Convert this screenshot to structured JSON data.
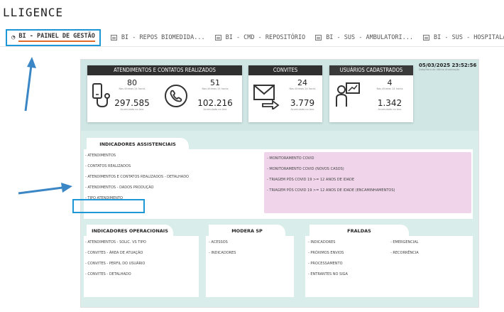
{
  "app": {
    "title": "LLIGENCE"
  },
  "tabs": [
    {
      "label": "BI - PAINEL DE GESTÃO",
      "active": true
    },
    {
      "label": "BI - REPOS BIOMEDIDA..."
    },
    {
      "label": "BI - CMD - REPOSITÓRIO"
    },
    {
      "label": "BI - SUS - AMBULATORI..."
    },
    {
      "label": "BI - SUS - HOSPITALAR"
    }
  ],
  "timestamp": {
    "value": "05/03/2025 23:52:56",
    "label": "Data/Hora da Última Atualização"
  },
  "cards": {
    "atendimentos": {
      "title": "ATENDIMENTOS E CONTATOS REALIZADOS",
      "left": {
        "value24": "80",
        "sub24": "Nas últimas 24 horas",
        "valueYear": "297.585",
        "subYear": "Acumulado no Ano"
      },
      "right": {
        "value24": "51",
        "sub24": "Nas últimas 24 horas",
        "valueYear": "102.216",
        "subYear": "Acumulado no Ano"
      }
    },
    "convites": {
      "title": "CONVITES",
      "value24": "24",
      "sub24": "Nas últimas 24 horas",
      "valueYear": "3.779",
      "subYear": "Acumulado no Ano"
    },
    "usuarios": {
      "title": "USUÁRIOS CADASTRADOS",
      "value24": "4",
      "sub24": "Nas últimas 24 horas",
      "valueYear": "1.342",
      "subYear": "Acumulado no Ano"
    }
  },
  "assistenciais": {
    "title": "INDICADORES ASSISTENCIAIS",
    "left_items": [
      "- ATENDIMENTOS",
      "- CONTATOS REALIZADOS",
      "- ATENDIMENTOS E CONTATOS REALIZADOS - DETALHADO",
      "- ATENDIMENTOS - DADOS PRODUÇÃO",
      "- TIPO ATENDIMENTO"
    ],
    "right_items": [
      "- MONITORAMENTO COVID",
      "- MONITORAMENTO COVID (NOVOS CASOS)",
      "- TRIAGEM PÓS COVID 19 >= 12 ANOS DE IDADE",
      "- TRIAGEM PÓS COVID 19 >= 12 ANOS DE IDADE (ENCAMINHAMENTOS)"
    ]
  },
  "operacionais": {
    "title": "INDICADORES OPERACIONAIS",
    "items": [
      "- ATENDIMENTOS - SOLIC. VS TIPO",
      "- CONVITES - ÁREA DE ATUAÇÃO",
      "- CONVITES - PERFIL DO USUÁRIO",
      "- CONVITES - DETALHADO"
    ]
  },
  "modera": {
    "title": "MODERA SP",
    "items": [
      "- ACESSOS",
      "- INDICADORES"
    ]
  },
  "fraldas": {
    "title": "FRALDAS",
    "col1": [
      "- INDICADORES",
      "- PRÓXIMOS ENVIOS",
      "- PROCESSAMENTO",
      "- ENTRANTES NO SIGA"
    ],
    "col2": [
      "- EMERGENCIAL",
      "- RECORRÊNCIA"
    ]
  },
  "colors": {
    "accent_blue": "#1d97d6",
    "active_underline": "#e26a2c",
    "card_header": "#2f2f2f",
    "pink_panel": "#f0d5ea"
  }
}
